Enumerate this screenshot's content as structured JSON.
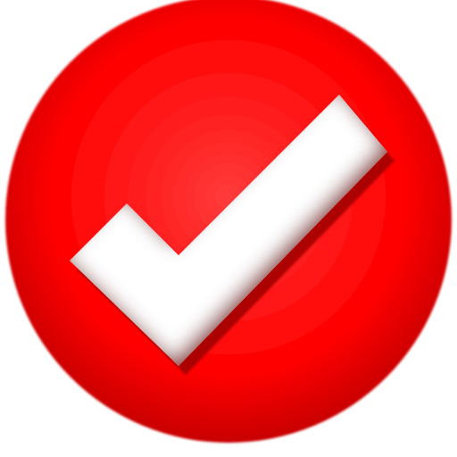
{
  "icon": {
    "name": "check-icon",
    "shape": "round-button-with-checkmark",
    "colors": {
      "background": "#ffffff",
      "disc": "#ff0000",
      "disc_highlight": "#ff3b3b",
      "disc_shadow": "#a40000",
      "disc_edge": "#c80000",
      "checkmark": "#ffffff",
      "checkmark_inner_shadow": "#8c0000"
    }
  }
}
